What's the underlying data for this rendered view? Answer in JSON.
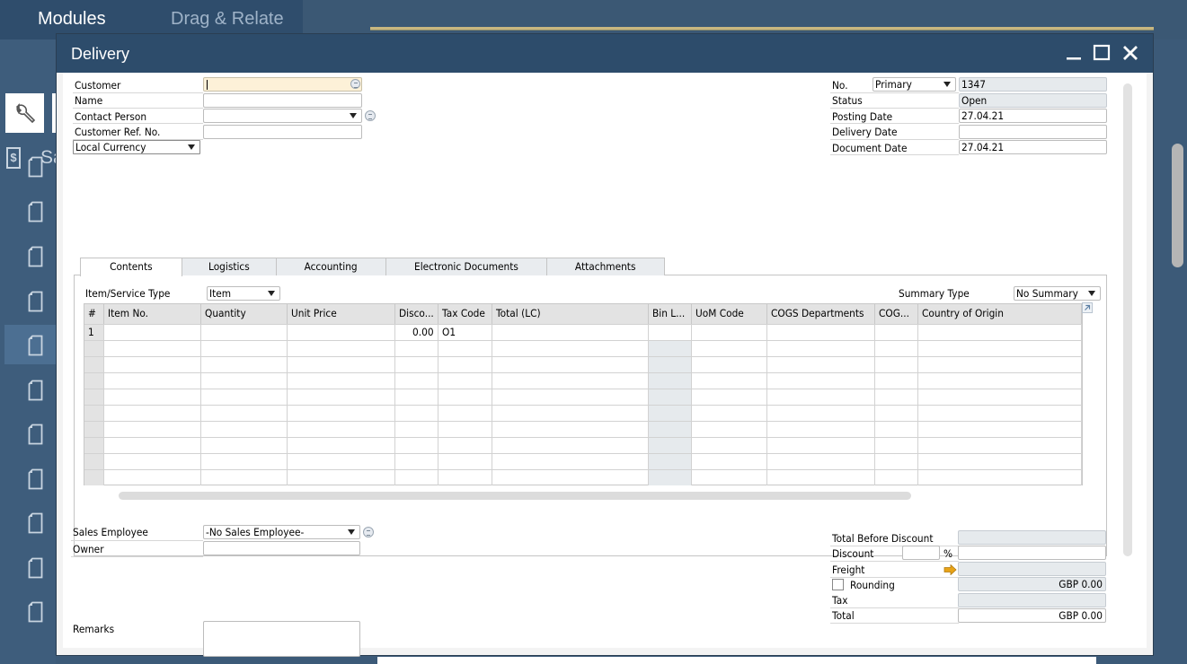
{
  "top_tabs": [
    {
      "label": "Modules",
      "active": true
    },
    {
      "label": "Drag & Relate",
      "active": false
    }
  ],
  "sidebar": {
    "module_short_label": "Sa",
    "icons": [
      "wrench-icon",
      "dollar-icon",
      "document-icon",
      "document-icon",
      "document-icon",
      "document-icon",
      "document-icon",
      "document-icon",
      "document-icon",
      "document-icon",
      "document-icon",
      "document-icon",
      "document-icon"
    ]
  },
  "window": {
    "title": "Delivery",
    "controls": {
      "minimize": "_",
      "maximize": "☐",
      "close": "✕"
    }
  },
  "header_left": {
    "customer_label": "Customer",
    "customer_value": "",
    "name_label": "Name",
    "name_value": "",
    "contact_label": "Contact Person",
    "contact_value": "",
    "custref_label": "Customer Ref. No.",
    "custref_value": "",
    "currency_select": "Local Currency"
  },
  "header_right": {
    "no_label": "No.",
    "series_select": "Primary",
    "no_value": "1347",
    "status_label": "Status",
    "status_value": "Open",
    "posting_label": "Posting Date",
    "posting_value": "27.04.21",
    "delivery_label": "Delivery Date",
    "delivery_value": "",
    "document_label": "Document Date",
    "document_value": "27.04.21"
  },
  "tabs": [
    {
      "label": "Contents",
      "active": true
    },
    {
      "label": "Logistics",
      "active": false
    },
    {
      "label": "Accounting",
      "active": false
    },
    {
      "label": "Electronic Documents",
      "active": false
    },
    {
      "label": "Attachments",
      "active": false
    }
  ],
  "contents": {
    "item_type_label": "Item/Service Type",
    "item_type_value": "Item",
    "summary_label": "Summary Type",
    "summary_value": "No Summary",
    "columns": [
      "#",
      "Item No.",
      "Quantity",
      "Unit Price",
      "Disco...",
      "Tax Code",
      "Total (LC)",
      "Bin L...",
      "UoM Code",
      "COGS Departments",
      "COG...",
      "Country of Origin"
    ],
    "rows": [
      [
        "1",
        "",
        "",
        "",
        "0.00",
        "O1",
        "",
        "",
        "",
        "",
        "",
        ""
      ],
      [
        "",
        "",
        "",
        "",
        "",
        "",
        "",
        "",
        "",
        "",
        "",
        ""
      ],
      [
        "",
        "",
        "",
        "",
        "",
        "",
        "",
        "",
        "",
        "",
        "",
        ""
      ],
      [
        "",
        "",
        "",
        "",
        "",
        "",
        "",
        "",
        "",
        "",
        "",
        ""
      ],
      [
        "",
        "",
        "",
        "",
        "",
        "",
        "",
        "",
        "",
        "",
        "",
        ""
      ],
      [
        "",
        "",
        "",
        "",
        "",
        "",
        "",
        "",
        "",
        "",
        "",
        ""
      ],
      [
        "",
        "",
        "",
        "",
        "",
        "",
        "",
        "",
        "",
        "",
        "",
        ""
      ],
      [
        "",
        "",
        "",
        "",
        "",
        "",
        "",
        "",
        "",
        "",
        "",
        ""
      ],
      [
        "",
        "",
        "",
        "",
        "",
        "",
        "",
        "",
        "",
        "",
        "",
        ""
      ],
      [
        "",
        "",
        "",
        "",
        "",
        "",
        "",
        "",
        "",
        "",
        "",
        ""
      ]
    ]
  },
  "footer_left": {
    "sales_emp_label": "Sales Employee",
    "sales_emp_value": "-No Sales Employee-",
    "owner_label": "Owner",
    "owner_value": "",
    "remarks_label": "Remarks",
    "remarks_value": ""
  },
  "totals": {
    "tbd_label": "Total Before Discount",
    "tbd_value": "",
    "discount_label": "Discount",
    "discount_pct": "",
    "pct_symbol": "%",
    "discount_value": "",
    "freight_label": "Freight",
    "freight_value": "",
    "rounding_label": "Rounding",
    "rounding_checked": false,
    "rounding_value": "GBP 0.00",
    "tax_label": "Tax",
    "tax_value": "",
    "total_label": "Total",
    "total_value": "GBP 0.00"
  },
  "colors": {
    "title_bar": "#2d4c6b",
    "accent_gold": "#c8b780",
    "focus_field": "#fdf1d8",
    "readonly_field": "#e6eaed",
    "freight_arrow": "#e8a317"
  }
}
